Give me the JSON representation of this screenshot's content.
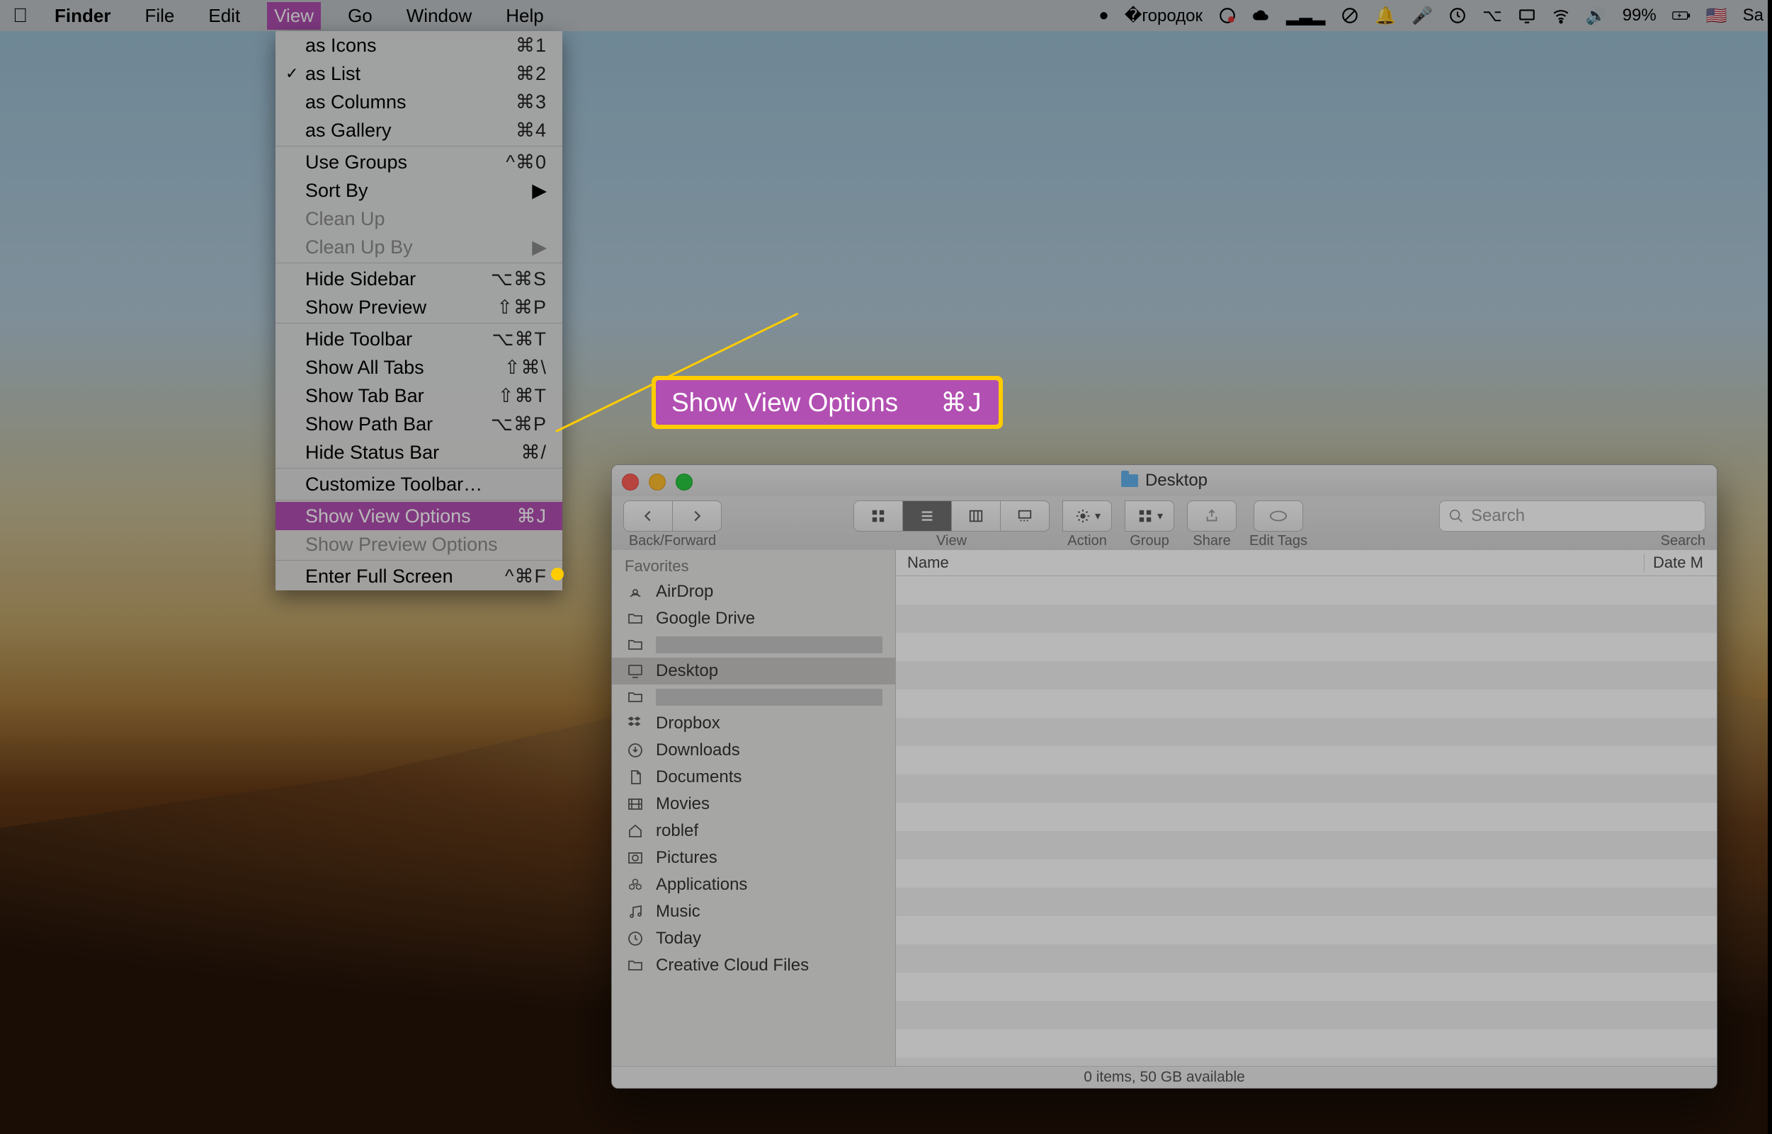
{
  "menubar": {
    "app": "Finder",
    "items": [
      "File",
      "Edit",
      "View",
      "Go",
      "Window",
      "Help"
    ],
    "active": "View",
    "battery": "99%",
    "rightEdge": "Sa"
  },
  "viewMenu": {
    "groups": [
      [
        {
          "label": "as Icons",
          "shortcut": "⌘1"
        },
        {
          "label": "as List",
          "shortcut": "⌘2",
          "checked": true
        },
        {
          "label": "as Columns",
          "shortcut": "⌘3"
        },
        {
          "label": "as Gallery",
          "shortcut": "⌘4"
        }
      ],
      [
        {
          "label": "Use Groups",
          "shortcut": "^⌘0"
        },
        {
          "label": "Sort By",
          "submenu": true
        },
        {
          "label": "Clean Up",
          "disabled": true
        },
        {
          "label": "Clean Up By",
          "submenu": true,
          "disabled": true
        }
      ],
      [
        {
          "label": "Hide Sidebar",
          "shortcut": "⌥⌘S"
        },
        {
          "label": "Show Preview",
          "shortcut": "⇧⌘P"
        }
      ],
      [
        {
          "label": "Hide Toolbar",
          "shortcut": "⌥⌘T"
        },
        {
          "label": "Show All Tabs",
          "shortcut": "⇧⌘\\"
        },
        {
          "label": "Show Tab Bar",
          "shortcut": "⇧⌘T"
        },
        {
          "label": "Show Path Bar",
          "shortcut": "⌥⌘P"
        },
        {
          "label": "Hide Status Bar",
          "shortcut": "⌘/"
        }
      ],
      [
        {
          "label": "Customize Toolbar…"
        }
      ],
      [
        {
          "label": "Show View Options",
          "shortcut": "⌘J",
          "highlight": true
        },
        {
          "label": "Show Preview Options",
          "disabled": true
        }
      ],
      [
        {
          "label": "Enter Full Screen",
          "shortcut": "^⌘F"
        }
      ]
    ]
  },
  "callout": {
    "label": "Show View Options",
    "shortcut": "⌘J"
  },
  "finder": {
    "title": "Desktop",
    "toolbar": {
      "back": "Back/Forward",
      "view": "View",
      "action": "Action",
      "group": "Group",
      "share": "Share",
      "edit": "Edit Tags",
      "search": "Search",
      "searchPlaceholder": "Search"
    },
    "sidebar": {
      "header": "Favorites",
      "items": [
        {
          "label": "AirDrop",
          "icon": "airdrop"
        },
        {
          "label": "Google Drive",
          "icon": "folder"
        },
        {
          "label": "",
          "icon": "folder",
          "redact": true
        },
        {
          "label": "Desktop",
          "icon": "desktop",
          "selected": true
        },
        {
          "label": "",
          "icon": "folder",
          "redact": true
        },
        {
          "label": "Dropbox",
          "icon": "dropbox"
        },
        {
          "label": "Downloads",
          "icon": "downloads"
        },
        {
          "label": "Documents",
          "icon": "documents"
        },
        {
          "label": "Movies",
          "icon": "movies"
        },
        {
          "label": "roblef",
          "icon": "home"
        },
        {
          "label": "Pictures",
          "icon": "pictures"
        },
        {
          "label": "Applications",
          "icon": "apps"
        },
        {
          "label": "Music",
          "icon": "music"
        },
        {
          "label": "Today",
          "icon": "clock"
        },
        {
          "label": "Creative Cloud Files",
          "icon": "folder"
        }
      ]
    },
    "columns": {
      "name": "Name",
      "date": "Date M"
    },
    "status": "0 items, 50 GB available"
  }
}
